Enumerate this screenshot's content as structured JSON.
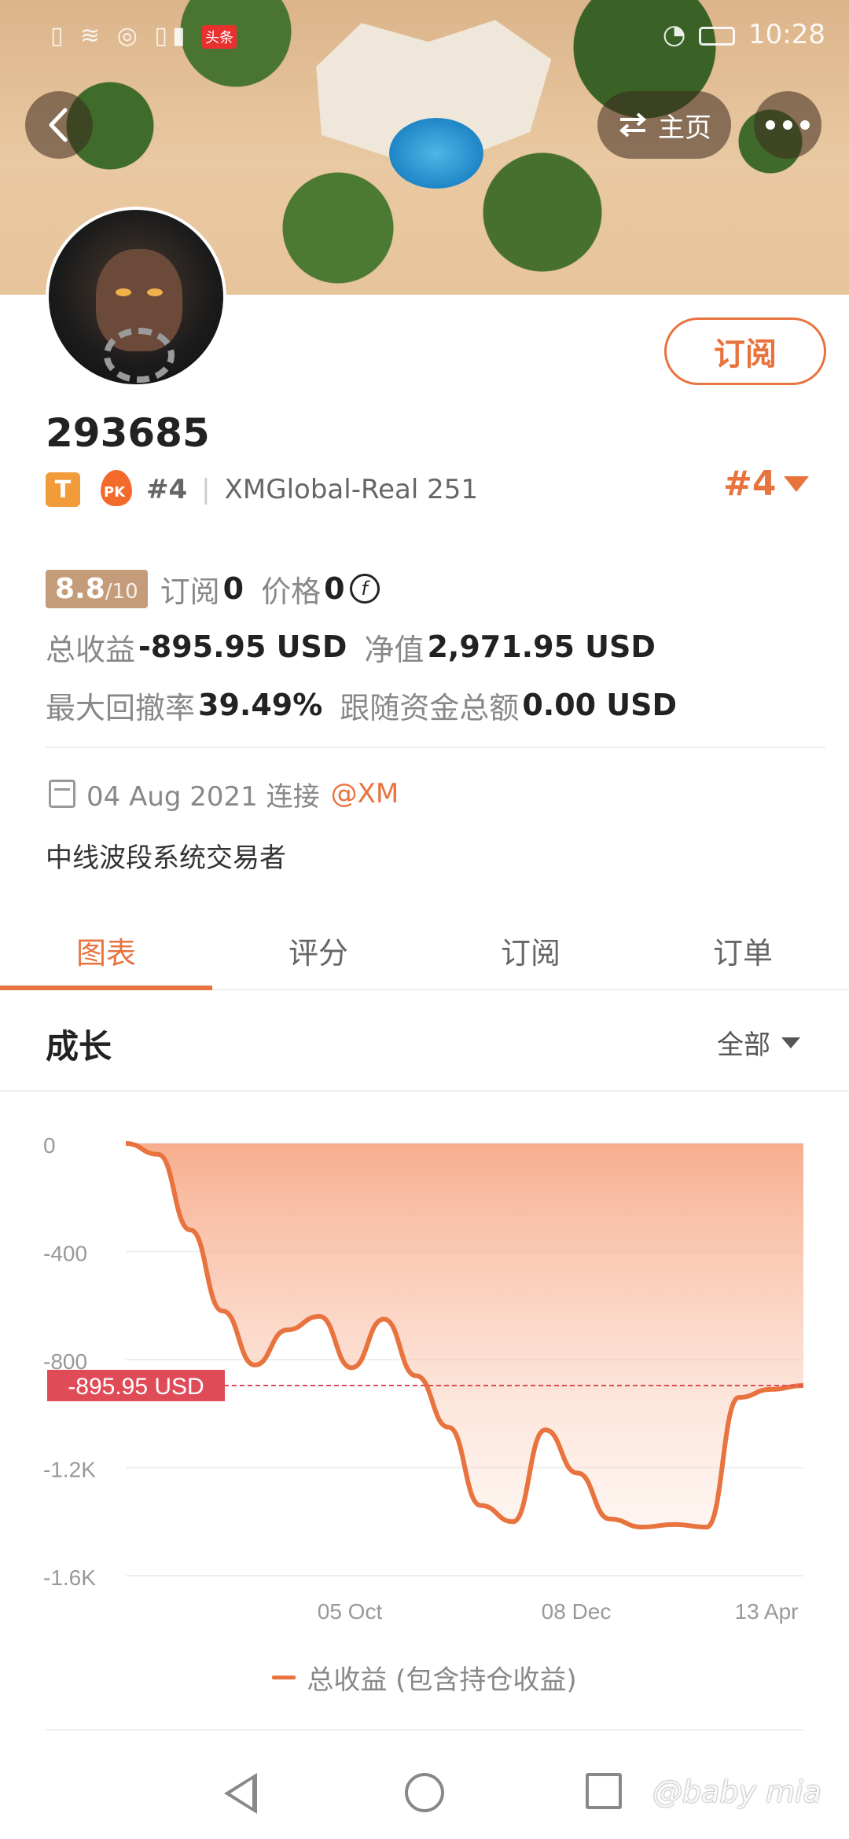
{
  "status_bar": {
    "time": "10:28",
    "news_badge": "头条"
  },
  "header": {
    "home_label": "主页"
  },
  "profile": {
    "username": "293685",
    "tier": "T",
    "pk_label": "PK",
    "rank_small": "#4",
    "server": "XMGlobal-Real 251",
    "rank_big": "#4",
    "subscribe_label": "订阅",
    "score": "8.8",
    "score_max": "/10",
    "subscriptions_label": "订阅",
    "subscriptions_value": "0",
    "price_label": "价格",
    "price_value": "0",
    "coin_symbol": "f",
    "total_profit_label": "总收益",
    "total_profit_value": "-895.95 USD",
    "net_value_label": "净值",
    "net_value_value": "2,971.95 USD",
    "max_drawdown_label": "最大回撤率",
    "max_drawdown_value": "39.49%",
    "follow_funds_label": "跟随资金总额",
    "follow_funds_value": "0.00 USD",
    "date_text": "04 Aug 2021 连接",
    "broker_link": "@XM",
    "bio": "中线波段系统交易者"
  },
  "tabs": [
    {
      "label": "图表",
      "active": true
    },
    {
      "label": "评分",
      "active": false
    },
    {
      "label": "订阅",
      "active": false
    },
    {
      "label": "订单",
      "active": false
    }
  ],
  "section": {
    "title": "成长",
    "filter_label": "全部"
  },
  "chart_data": {
    "type": "area",
    "ylim": [
      -1600,
      0
    ],
    "yticks": [
      "0",
      "-400",
      "-800",
      "-1.2K",
      "-1.6K"
    ],
    "xticks": [
      "05 Oct",
      "08 Dec",
      "13 Apr"
    ],
    "current_label": "-895.95 USD",
    "current_value": -895.95,
    "series": [
      {
        "name": "总收益 (包含持仓收益)",
        "color": "#e8733e",
        "values": [
          0,
          -40,
          -320,
          -620,
          -820,
          -690,
          -640,
          -830,
          -650,
          -860,
          -1050,
          -1340,
          -1400,
          -1060,
          -1220,
          -1390,
          -1420,
          -1410,
          -1420,
          -940,
          -910,
          -895.95
        ]
      }
    ]
  },
  "legend": {
    "label": "总收益 (包含持仓收益)"
  },
  "watermark": "@baby mia"
}
